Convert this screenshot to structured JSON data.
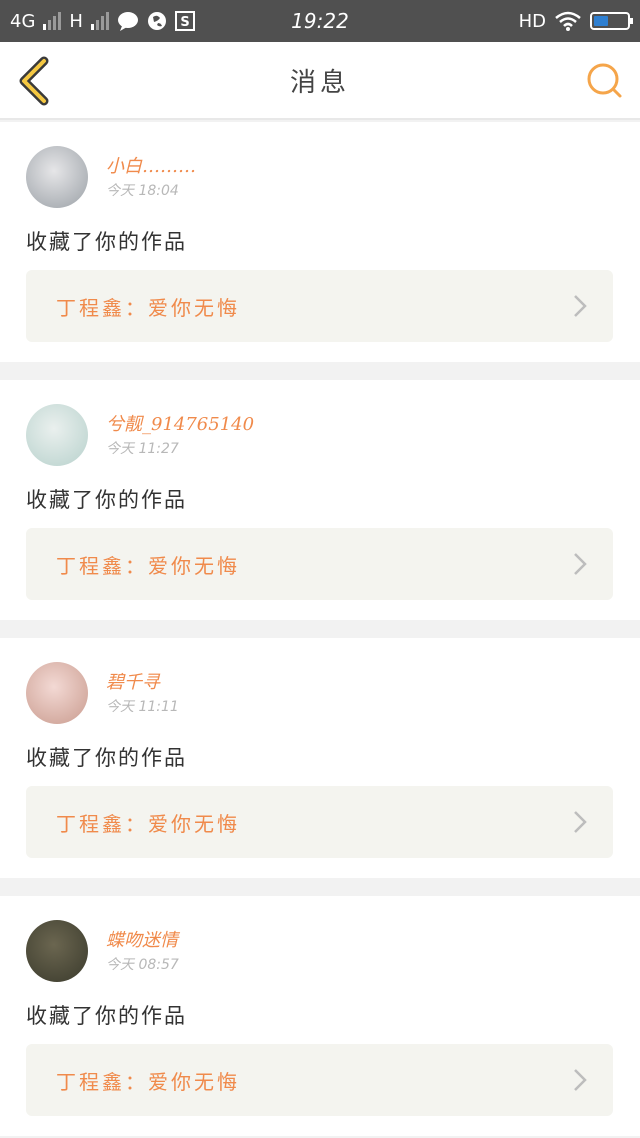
{
  "status_bar": {
    "network_left": "4G",
    "network_right": "H",
    "time": "19:22",
    "hd_label": "HD",
    "icons": [
      "signal-icon",
      "chat-icon",
      "globe-icon",
      "s-app-icon",
      "wifi-icon",
      "battery-icon"
    ],
    "battery_level": 0.45
  },
  "header": {
    "title": "消息",
    "back_icon": "chevron-left-icon",
    "search_icon": "search-icon",
    "accent_color": "#f5a54a"
  },
  "notifications": [
    {
      "user_name": "小白………",
      "time": "今天 18:04",
      "action": "收藏了你的作品",
      "work_title": "丁程鑫：爱你无悔",
      "avatar_colors": [
        "#e6e6e8",
        "#9aa0a6"
      ]
    },
    {
      "user_name": "兮靓_914765140",
      "time": "今天 11:27",
      "action": "收藏了你的作品",
      "work_title": "丁程鑫：爱你无悔",
      "avatar_colors": [
        "#eaf0ee",
        "#b7d1cc"
      ]
    },
    {
      "user_name": "碧千寻",
      "time": "今天 11:11",
      "action": "收藏了你的作品",
      "work_title": "丁程鑫：爱你无悔",
      "avatar_colors": [
        "#f3d9d4",
        "#c99b8e"
      ]
    },
    {
      "user_name": "蝶吻迷情",
      "time": "今天 08:57",
      "action": "收藏了你的作品",
      "work_title": "丁程鑫：爱你无悔",
      "avatar_colors": [
        "#6b6650",
        "#3a3a2c"
      ]
    }
  ],
  "colors": {
    "name": "#f08a4b",
    "work_box_bg": "#f4f4ef",
    "chevron": "#bdbdbd"
  }
}
